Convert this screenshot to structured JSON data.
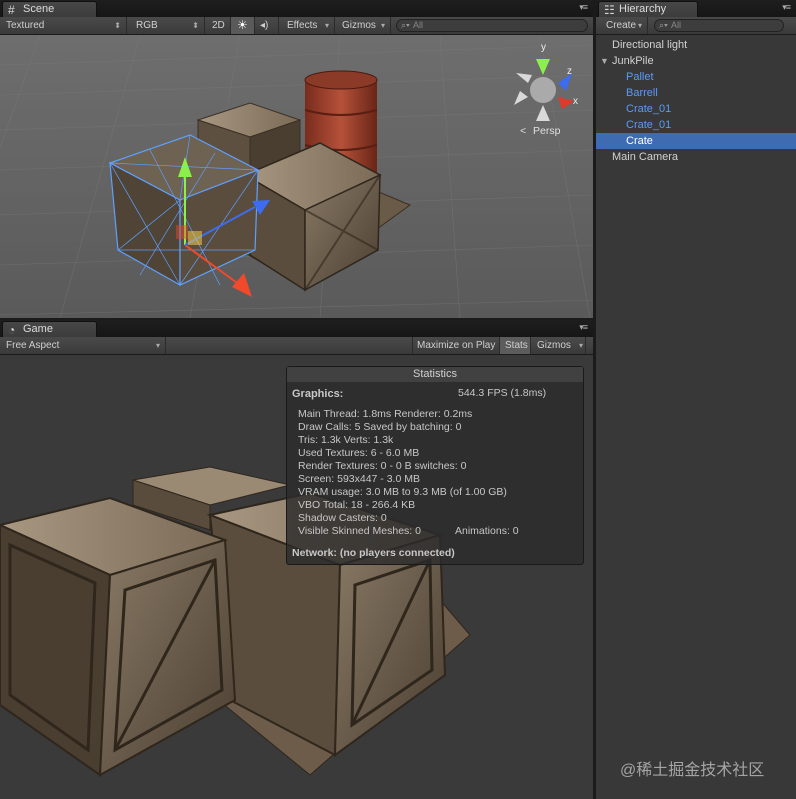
{
  "scene": {
    "tab": "Scene",
    "toolbar": {
      "render_mode": "Textured",
      "color_mode": "RGB",
      "btn_2d": "2D",
      "lighting_icon": "sun-icon",
      "audio_icon": "speaker-icon",
      "effects": "Effects",
      "gizmos": "Gizmos",
      "search_placeholder": "All"
    },
    "gizmo": {
      "labels": [
        "y",
        "z",
        "x"
      ],
      "projection": "Persp"
    }
  },
  "hierarchy": {
    "tab": "Hierarchy",
    "create": "Create",
    "search_placeholder": "All",
    "items": [
      {
        "label": "Directional light",
        "type": "normal"
      },
      {
        "label": "JunkPile",
        "type": "parent"
      },
      {
        "label": "Pallet",
        "type": "prefab"
      },
      {
        "label": "Barrell",
        "type": "prefab"
      },
      {
        "label": "Crate_01",
        "type": "prefab"
      },
      {
        "label": "Crate_01",
        "type": "prefab"
      },
      {
        "label": "Crate",
        "type": "selected"
      },
      {
        "label": "Main Camera",
        "type": "normal"
      }
    ]
  },
  "game": {
    "tab": "Game",
    "aspect": "Free Aspect",
    "maximize": "Maximize on Play",
    "stats_btn": "Stats",
    "gizmos": "Gizmos"
  },
  "statistics": {
    "title": "Statistics",
    "graphics_label": "Graphics:",
    "fps": "544.3 FPS (1.8ms)",
    "lines": [
      "Main Thread: 1.8ms  Renderer: 0.2ms",
      "Draw Calls: 5  Saved by batching: 0",
      "Tris: 1.3k   Verts: 1.3k",
      "Used Textures: 6 - 6.0 MB",
      "Render Textures: 0 - 0 B   switches: 0",
      "Screen: 593x447 - 3.0 MB",
      "VRAM usage: 3.0 MB to 9.3 MB (of 1.00 GB)",
      "VBO Total: 18 - 266.4 KB",
      "Shadow Casters: 0"
    ],
    "skinned": "Visible Skinned Meshes: 0",
    "animations": "Animations: 0",
    "network": "Network: (no players connected)"
  },
  "watermark": "@稀土掘金技术社区",
  "colors": {
    "selection": "#3e6bb1",
    "prefab_text": "#5b9bf8",
    "panel_bg": "#2a2a2a"
  }
}
